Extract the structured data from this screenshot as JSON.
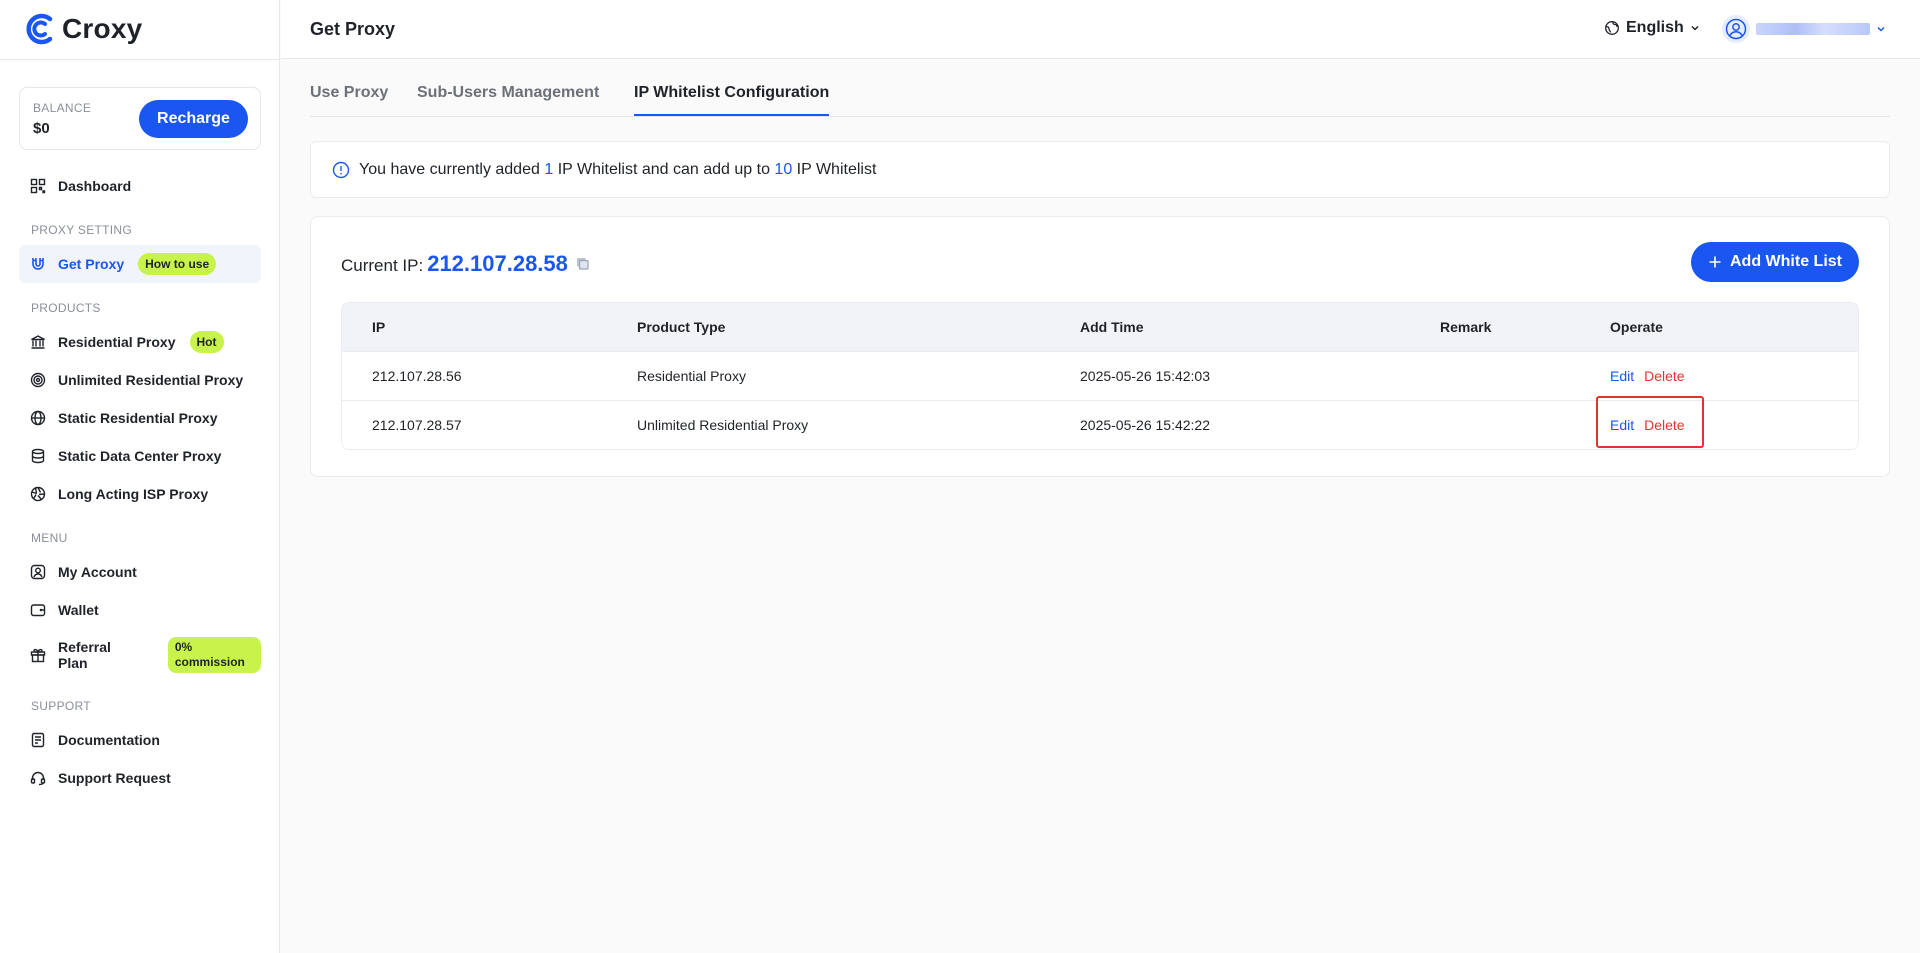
{
  "app": {
    "name": "Croxy"
  },
  "balance": {
    "label": "BALANCE",
    "value": "$0",
    "recharge_label": "Recharge"
  },
  "sidebar": {
    "dashboard": "Dashboard",
    "sections": {
      "proxy_setting": "PROXY SETTING",
      "products": "PRODUCTS",
      "menu": "MENU",
      "support": "SUPPORT"
    },
    "get_proxy": {
      "label": "Get Proxy",
      "badge": "How to use"
    },
    "products": [
      {
        "label": "Residential Proxy",
        "badge": "Hot",
        "icon": "bank-icon"
      },
      {
        "label": "Unlimited Residential Proxy",
        "icon": "target-icon"
      },
      {
        "label": "Static Residential Proxy",
        "icon": "globe-icon"
      },
      {
        "label": "Static Data Center Proxy",
        "icon": "database-icon"
      },
      {
        "label": "Long Acting ISP Proxy",
        "icon": "aperture-icon"
      }
    ],
    "menu": [
      {
        "label": "My Account",
        "icon": "user-square-icon"
      },
      {
        "label": "Wallet",
        "icon": "wallet-icon"
      },
      {
        "label": "Referral Plan",
        "badge": "0% commission",
        "icon": "gift-icon"
      }
    ],
    "support": [
      {
        "label": "Documentation",
        "icon": "document-icon"
      },
      {
        "label": "Support Request",
        "icon": "headset-icon"
      }
    ]
  },
  "header": {
    "title": "Get Proxy",
    "language": "English"
  },
  "tabs": [
    {
      "label": "Use Proxy",
      "active": false
    },
    {
      "label": "Sub-Users Management",
      "active": false
    },
    {
      "label": "IP Whitelist Configuration",
      "active": true
    }
  ],
  "notice": {
    "part1": "You have currently added",
    "added": "1",
    "part2": "IP Whitelist and can add up to",
    "max": "10",
    "part3": "IP Whitelist"
  },
  "whitelist": {
    "current_ip_label": "Current IP:",
    "current_ip": "212.107.28.58",
    "add_label": "Add White List",
    "columns": [
      "IP",
      "Product Type",
      "Add Time",
      "Remark",
      "Operate"
    ],
    "rows": [
      {
        "ip": "212.107.28.56",
        "product": "Residential Proxy",
        "time": "2025-05-26 15:42:03",
        "remark": "",
        "edit": "Edit",
        "delete": "Delete"
      },
      {
        "ip": "212.107.28.57",
        "product": "Unlimited Residential Proxy",
        "time": "2025-05-26 15:42:22",
        "remark": "",
        "edit": "Edit",
        "delete": "Delete"
      }
    ]
  },
  "colors": {
    "accent": "#1a56f0",
    "danger": "#e5322d",
    "lime": "#c8f34a"
  }
}
